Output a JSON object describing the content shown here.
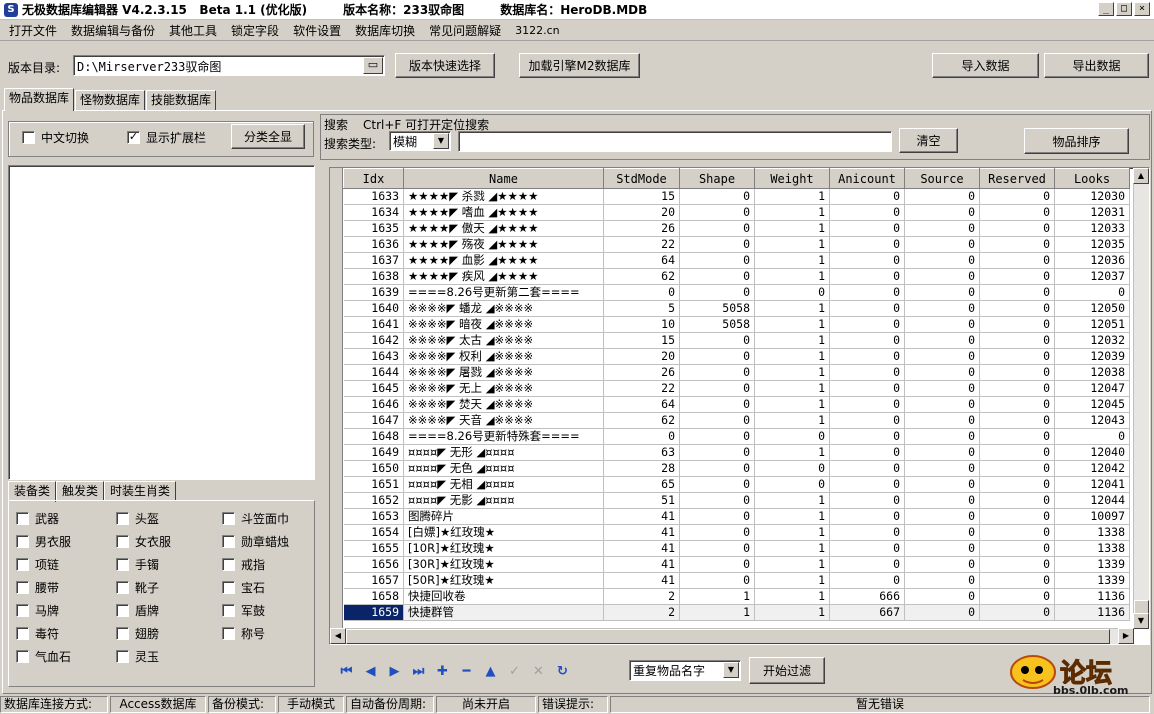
{
  "titlebar": {
    "app_name": "无极数据库编辑器 V4.2.3.15   Beta 1.1 (优化版)",
    "version_label": "版本名称：233驭命图",
    "db_label": "数据库名：HeroDB.MDB",
    "minimize": "_",
    "maximize": "□",
    "close": "×"
  },
  "menu": [
    "打开文件",
    "数据编辑与备份",
    "其他工具",
    "锁定字段",
    "软件设置",
    "数据库切换",
    "常见问题解疑",
    "3122.cn"
  ],
  "toolbar": {
    "dir_label": "版本目录:",
    "dir_value": "D:\\Mirserver233驭命图",
    "quick_select": "版本快速选择",
    "load_engine": "加载引擎M2数据库",
    "import": "导入数据",
    "export": "导出数据"
  },
  "tabs": [
    "物品数据库",
    "怪物数据库",
    "技能数据库"
  ],
  "left_panel": {
    "chinese_switch": "中文切换",
    "show_extend": "显示扩展栏",
    "show_all": "分类全显",
    "subtabs": [
      "装备类",
      "触发类",
      "时装生肖类"
    ],
    "categories": [
      [
        "武器",
        "头盔",
        "斗笠面巾"
      ],
      [
        "男衣服",
        "女衣服",
        "勋章蜡烛"
      ],
      [
        "项链",
        "手镯",
        "戒指"
      ],
      [
        "腰带",
        "靴子",
        "宝石"
      ],
      [
        "马牌",
        "盾牌",
        "军鼓"
      ],
      [
        "毒符",
        "翅膀",
        "称号"
      ],
      [
        "气血石",
        "灵玉",
        ""
      ]
    ]
  },
  "search": {
    "label": "搜索",
    "hint": "Ctrl+F 可打开定位搜索",
    "type_label": "搜索类型:",
    "type_value": "模糊",
    "query": "",
    "clear": "清空",
    "sort": "物品排序"
  },
  "grid": {
    "columns": [
      "Idx",
      "Name",
      "StdMode",
      "Shape",
      "Weight",
      "Anicount",
      "Source",
      "Reserved",
      "Looks"
    ],
    "rows": [
      [
        "1633",
        "★★★★◤ 杀戮 ◢★★★★",
        "15",
        "0",
        "1",
        "0",
        "0",
        "0",
        "12030"
      ],
      [
        "1634",
        "★★★★◤ 嗜血 ◢★★★★",
        "20",
        "0",
        "1",
        "0",
        "0",
        "0",
        "12031"
      ],
      [
        "1635",
        "★★★★◤ 傲天 ◢★★★★",
        "26",
        "0",
        "1",
        "0",
        "0",
        "0",
        "12033"
      ],
      [
        "1636",
        "★★★★◤ 殇夜 ◢★★★★",
        "22",
        "0",
        "1",
        "0",
        "0",
        "0",
        "12035"
      ],
      [
        "1637",
        "★★★★◤ 血影 ◢★★★★",
        "64",
        "0",
        "1",
        "0",
        "0",
        "0",
        "12036"
      ],
      [
        "1638",
        "★★★★◤ 疾风 ◢★★★★",
        "62",
        "0",
        "1",
        "0",
        "0",
        "0",
        "12037"
      ],
      [
        "1639",
        "====8.26号更新第二套====",
        "0",
        "0",
        "0",
        "0",
        "0",
        "0",
        "0"
      ],
      [
        "1640",
        "※※※※◤ 蟠龙 ◢※※※※",
        "5",
        "5058",
        "1",
        "0",
        "0",
        "0",
        "12050"
      ],
      [
        "1641",
        "※※※※◤ 暗夜 ◢※※※※",
        "10",
        "5058",
        "1",
        "0",
        "0",
        "0",
        "12051"
      ],
      [
        "1642",
        "※※※※◤ 太古 ◢※※※※",
        "15",
        "0",
        "1",
        "0",
        "0",
        "0",
        "12032"
      ],
      [
        "1643",
        "※※※※◤ 权利 ◢※※※※",
        "20",
        "0",
        "1",
        "0",
        "0",
        "0",
        "12039"
      ],
      [
        "1644",
        "※※※※◤ 屠戮 ◢※※※※",
        "26",
        "0",
        "1",
        "0",
        "0",
        "0",
        "12038"
      ],
      [
        "1645",
        "※※※※◤ 无上 ◢※※※※",
        "22",
        "0",
        "1",
        "0",
        "0",
        "0",
        "12047"
      ],
      [
        "1646",
        "※※※※◤ 焚天 ◢※※※※",
        "64",
        "0",
        "1",
        "0",
        "0",
        "0",
        "12045"
      ],
      [
        "1647",
        "※※※※◤ 天音 ◢※※※※",
        "62",
        "0",
        "1",
        "0",
        "0",
        "0",
        "12043"
      ],
      [
        "1648",
        "====8.26号更新特殊套====",
        "0",
        "0",
        "0",
        "0",
        "0",
        "0",
        "0"
      ],
      [
        "1649",
        "¤¤¤¤◤ 无形 ◢¤¤¤¤",
        "63",
        "0",
        "1",
        "0",
        "0",
        "0",
        "12040"
      ],
      [
        "1650",
        "¤¤¤¤◤ 无色 ◢¤¤¤¤",
        "28",
        "0",
        "0",
        "0",
        "0",
        "0",
        "12042"
      ],
      [
        "1651",
        "¤¤¤¤◤ 无相 ◢¤¤¤¤",
        "65",
        "0",
        "0",
        "0",
        "0",
        "0",
        "12041"
      ],
      [
        "1652",
        "¤¤¤¤◤ 无影 ◢¤¤¤¤",
        "51",
        "0",
        "1",
        "0",
        "0",
        "0",
        "12044"
      ],
      [
        "1653",
        "图腾碎片",
        "41",
        "0",
        "1",
        "0",
        "0",
        "0",
        "10097"
      ],
      [
        "1654",
        "[白嫖]★红玫瑰★",
        "41",
        "0",
        "1",
        "0",
        "0",
        "0",
        "1338"
      ],
      [
        "1655",
        "[10R]★红玫瑰★",
        "41",
        "0",
        "1",
        "0",
        "0",
        "0",
        "1338"
      ],
      [
        "1656",
        "[30R]★红玫瑰★",
        "41",
        "0",
        "1",
        "0",
        "0",
        "0",
        "1339"
      ],
      [
        "1657",
        "[50R]★红玫瑰★",
        "41",
        "0",
        "1",
        "0",
        "0",
        "0",
        "1339"
      ],
      [
        "1658",
        "快捷回收卷",
        "2",
        "1",
        "1",
        "666",
        "0",
        "0",
        "1136"
      ],
      [
        "1659",
        "快捷群管",
        "2",
        "1",
        "1",
        "667",
        "0",
        "0",
        "1136"
      ]
    ],
    "selected_index": 26
  },
  "bottom": {
    "filter_value": "重复物品名字",
    "filter_button": "开始过滤"
  },
  "statusbar": [
    "数据库连接方式:",
    "Access数据库",
    "备份模式:",
    "手动模式",
    "自动备份周期:",
    "尚未开启",
    "错误提示:",
    "暂无错误"
  ],
  "watermark": {
    "brand": "论坛",
    "url": "bbs.0lb.com"
  }
}
